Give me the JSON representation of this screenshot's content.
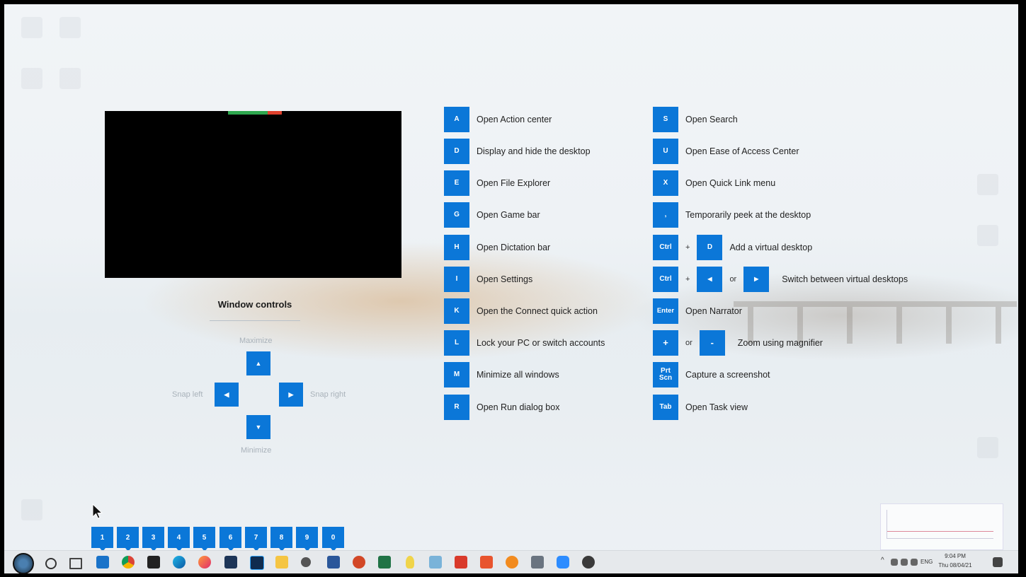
{
  "preview": {},
  "window_controls": {
    "title": "Window controls",
    "maximize": "Maximize",
    "minimize": "Minimize",
    "snap_left": "Snap left",
    "snap_right": "Snap right",
    "up_glyph": "▲",
    "down_glyph": "▼",
    "left_glyph": "◀",
    "right_glyph": "▶"
  },
  "shortcuts_left": [
    {
      "key": "A",
      "desc": "Open Action center"
    },
    {
      "key": "D",
      "desc": "Display and hide the desktop"
    },
    {
      "key": "E",
      "desc": "Open File Explorer"
    },
    {
      "key": "G",
      "desc": "Open Game bar"
    },
    {
      "key": "H",
      "desc": "Open Dictation bar"
    },
    {
      "key": "I",
      "desc": "Open Settings"
    },
    {
      "key": "K",
      "desc": "Open the Connect quick action"
    },
    {
      "key": "L",
      "desc": "Lock your PC or switch accounts"
    },
    {
      "key": "M",
      "desc": "Minimize all windows"
    },
    {
      "key": "R",
      "desc": "Open Run dialog box"
    }
  ],
  "shortcuts_right": {
    "s": {
      "key": "S",
      "desc": "Open Search"
    },
    "u": {
      "key": "U",
      "desc": "Open Ease of Access Center"
    },
    "x": {
      "key": "X",
      "desc": "Open Quick Link menu"
    },
    "comma": {
      "key": ",",
      "desc": "Temporarily peek at the desktop"
    },
    "ctrl_d": {
      "key1": "Ctrl",
      "plus": "+",
      "key2": "D",
      "desc": "Add a virtual desktop"
    },
    "ctrl_arrows": {
      "key1": "Ctrl",
      "plus": "+",
      "key2": "◀",
      "or": "or",
      "key3": "▶",
      "desc": "Switch between virtual desktops"
    },
    "enter": {
      "key": "Enter",
      "desc": "Open Narrator"
    },
    "zoom": {
      "key1": "+",
      "or": "or",
      "key2": "-",
      "desc": "Zoom using magnifier"
    },
    "prtscn": {
      "key_line1": "Prt",
      "key_line2": "Scn",
      "desc": "Capture a screenshot"
    },
    "tab": {
      "key": "Tab",
      "desc": "Open Task view"
    }
  },
  "taskbar_numbers": [
    "1",
    "2",
    "3",
    "4",
    "5",
    "6",
    "7",
    "8",
    "9",
    "0"
  ],
  "tray": {
    "language": "ENG",
    "time": "9:04 PM",
    "date": "Thu 08/04/21"
  },
  "colors": {
    "key_blue": "#0b77d8",
    "preview_black": "#000000"
  }
}
